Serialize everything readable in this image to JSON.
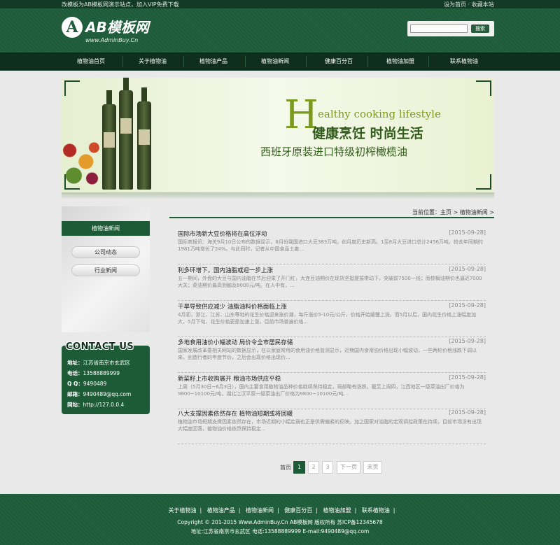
{
  "topbar": {
    "left_text": "改模板为AB模板网演示站点，加入VIP免费下载",
    "right_text": "设为首页 · 收藏本站"
  },
  "logo": {
    "mark": "A",
    "name": "AB模板网",
    "url": "www.AdminBuy.Cn"
  },
  "search": {
    "placeholder": "",
    "button_label": "搜索"
  },
  "nav": {
    "items": [
      "植物油首页",
      "关于植物油",
      "植物油产品",
      "植物油新闻",
      "健康百分百",
      "植物油加盟",
      "联系植物油"
    ]
  },
  "banner": {
    "en_big": "H",
    "en_rest": "ealthy cooking lifestyle",
    "cn_line1": "健康烹饪 时尚生活",
    "cn_line2": "西班牙原装进口特级初榨橄榄油"
  },
  "sidebar": {
    "title": "植物油新闻",
    "items": [
      "公司动态",
      "行业新闻"
    ]
  },
  "contact": {
    "title": "CONTACT US",
    "lines": [
      {
        "label": "地址：",
        "value": "江苏省南京市玄武区"
      },
      {
        "label": "电话：",
        "value": "13588889999"
      },
      {
        "label": "Q Q：",
        "value": "9490489"
      },
      {
        "label": "邮箱：",
        "value": "9490489@qq.com"
      },
      {
        "label": "网站：",
        "value": "http://127.0.0.4"
      }
    ]
  },
  "breadcrumb": "当前位置：主页 > 植物油新闻 >",
  "news": [
    {
      "title": "国际市场新大豆价格将在高位浮动",
      "date": "[2015-09-28]",
      "summary": "国际商报讯：海关9月10日公布的数据显示，8月份我国进口大豆383万吨，创月度历史新高。1至8月大豆进口总计2456万吨，较去年同期的1981万吨增长了24%。与此同时，记者从中国食品土畜..."
    },
    {
      "title": "利多环增下，国内油脂或迎一步上涨",
      "date": "[2015-09-28]",
      "summary": "五一期间，外盘的大豆与国内油脂在节后迎来了开门红，大连豆油期价在现货坚挺提振带动下，突破前7500一线；而棕榈油期价也逼近7000大关；菜油期价最高到触及8000元/吨。在人中有，..."
    },
    {
      "title": "干旱导致供应减少 油脂油料价格面临上涨",
      "date": "[2015-09-28]",
      "summary": "4月初，浙江、江苏、山东等地的花生价格迎来涨价潮，每斤涨价5-10元/公斤，价格开始缓慢上涨。而5月以后，国内花生价格上涨幅度加大，5月下旬，花生价格更是加速上涨，目前市场普遍价格..."
    },
    {
      "title": "多地食用油价小幅波动 局价令全市居民存储",
      "date": "[2015-09-28]",
      "summary": "国家发展改革委相关网站的数据显示，在以家庭常用的食用油价格监测显示，近期国内食用油价格出现小幅波动，一些两轮价格涨跌下调以来，创造行者的年度节价，之后会出现价格出现价..."
    },
    {
      "title": "新菜籽上市收购展开 粮油市场供应平稳",
      "date": "[2015-09-28]",
      "summary": "上周（5月30日~6月3日），国内主要食用植物油品种价格继续保持稳定，局部略有涨跌。截至上周四，江西地区一级菜油出厂价格为9800~10100元/吨，湖北江汉平原一级菜油出厂价格为9800~10100元/吨..."
    },
    {
      "title": "八大支撑因素依然存在 植物油短期或将回暖",
      "date": "[2015-09-28]",
      "summary": "植物油市场短期支撑因素依然存在，市场近期的小幅走弱也正是供需偏紧的反映。加之国家对油脂的宏观调控政策在持续，目前市场没有出现大幅度回落，植物油价格依然保持稳定..."
    }
  ],
  "pager": {
    "first_label": "首页",
    "pages": [
      "1",
      "2",
      "3"
    ],
    "next_label": "下一页",
    "last_label": "末页"
  },
  "footer": {
    "links": [
      "关于植物油",
      "植物油产品",
      "植物油新闻",
      "健康百分百",
      "植物油加盟",
      "联系植物油"
    ],
    "copyright": "Copyright © 201-2015 Www.AdminBuy.Cn AB模板网 版权所有  苏ICP备12345678",
    "address": "地址:江苏省南京市玄武区   电话:13588889999   E-mail:9490489@qq.com"
  }
}
